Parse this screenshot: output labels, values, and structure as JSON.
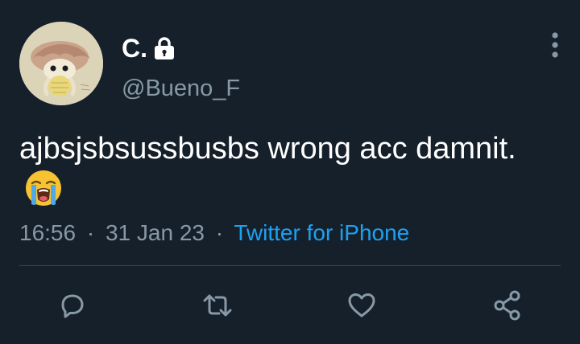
{
  "user": {
    "display_name": "C.",
    "handle": "@Bueno_F",
    "protected_icon": "lock-icon",
    "avatar_icon": "mushroom-character-avatar"
  },
  "tweet": {
    "text": "ajbsjsbsussbusbs wrong acc damnit.",
    "emoji": "loudly-crying-face-emoji"
  },
  "meta": {
    "time": "16:56",
    "separator": "·",
    "date": "31 Jan 23",
    "source": "Twitter for iPhone"
  },
  "actions": {
    "reply_icon": "reply-icon",
    "retweet_icon": "retweet-icon",
    "like_icon": "heart-icon",
    "share_icon": "share-icon"
  },
  "colors": {
    "background": "#15202b",
    "text": "#ffffff",
    "secondary_text": "#8899a6",
    "link": "#1da1f2",
    "divider": "#38444d"
  }
}
